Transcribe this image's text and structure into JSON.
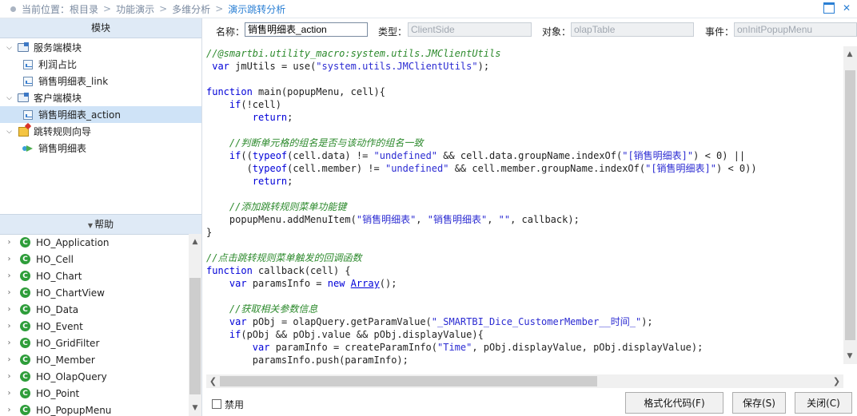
{
  "breadcrumb": {
    "prefix": "当前位置：",
    "items": [
      "根目录",
      "功能演示",
      "多维分析"
    ],
    "current": "演示跳转分析",
    "separator": ">"
  },
  "left_panel": {
    "module_header": "模块",
    "tree": [
      {
        "label": "服务端模块",
        "icon": "folder-icon",
        "expanded": true
      },
      {
        "label": "利润占比",
        "icon": "macro-doc-icon"
      },
      {
        "label": "销售明细表_link",
        "icon": "macro-doc-icon"
      },
      {
        "label": "客户端模块",
        "icon": "folder-icon",
        "expanded": true
      },
      {
        "label": "销售明细表_action",
        "icon": "macro-doc-icon",
        "selected": true
      },
      {
        "label": "跳转规则向导",
        "icon": "wizard-icon",
        "expanded": true
      },
      {
        "label": "销售明细表",
        "icon": "jump-rule-icon"
      }
    ],
    "help_header": "帮助",
    "help_items": [
      "HO_Application",
      "HO_Cell",
      "HO_Chart",
      "HO_ChartView",
      "HO_Data",
      "HO_Event",
      "HO_GridFilter",
      "HO_Member",
      "HO_OlapQuery",
      "HO_Point",
      "HO_PopupMenu"
    ]
  },
  "props": {
    "name_label": "名称：",
    "name_value": "销售明细表_action",
    "type_label": "类型：",
    "type_value": "ClientSide",
    "object_label": "对象：",
    "object_value": "olapTable",
    "event_label": "事件：",
    "event_value": "onInitPopupMenu"
  },
  "code_lines": [
    [
      {
        "t": "//@smartbi.utility_macro:system.utils.JMClientUtils",
        "c": "cm"
      }
    ],
    [
      {
        "t": " "
      },
      {
        "t": "var",
        "c": "kw"
      },
      {
        "t": " jmUtils = use("
      },
      {
        "t": "\"system.utils.JMClientUtils\"",
        "c": "str"
      },
      {
        "t": ");"
      }
    ],
    [],
    [
      {
        "t": "function",
        "c": "kw"
      },
      {
        "t": " main(popupMenu, cell){"
      }
    ],
    [
      {
        "t": "    "
      },
      {
        "t": "if",
        "c": "kw"
      },
      {
        "t": "(!cell)"
      }
    ],
    [
      {
        "t": "        "
      },
      {
        "t": "return",
        "c": "kw"
      },
      {
        "t": ";"
      }
    ],
    [],
    [
      {
        "t": "    "
      },
      {
        "t": "//判断单元格的组名是否与该动作的组名一致",
        "c": "cm"
      }
    ],
    [
      {
        "t": "    "
      },
      {
        "t": "if",
        "c": "kw"
      },
      {
        "t": "(("
      },
      {
        "t": "typeof",
        "c": "kw"
      },
      {
        "t": "(cell.data) != "
      },
      {
        "t": "\"undefined\"",
        "c": "str"
      },
      {
        "t": " && cell.data.groupName.indexOf("
      },
      {
        "t": "\"[销售明细表]\"",
        "c": "str"
      },
      {
        "t": ") < 0) ||"
      }
    ],
    [
      {
        "t": "       ("
      },
      {
        "t": "typeof",
        "c": "kw"
      },
      {
        "t": "(cell.member) != "
      },
      {
        "t": "\"undefined\"",
        "c": "str"
      },
      {
        "t": " && cell.member.groupName.indexOf("
      },
      {
        "t": "\"[销售明细表]\"",
        "c": "str"
      },
      {
        "t": ") < 0))"
      }
    ],
    [
      {
        "t": "        "
      },
      {
        "t": "return",
        "c": "kw"
      },
      {
        "t": ";"
      }
    ],
    [],
    [
      {
        "t": "    "
      },
      {
        "t": "//添加跳转规则菜单功能键",
        "c": "cm"
      }
    ],
    [
      {
        "t": "    popupMenu.addMenuItem("
      },
      {
        "t": "\"销售明细表\"",
        "c": "str"
      },
      {
        "t": ", "
      },
      {
        "t": "\"销售明细表\"",
        "c": "str"
      },
      {
        "t": ", "
      },
      {
        "t": "\"\"",
        "c": "str"
      },
      {
        "t": ", callback);"
      }
    ],
    [
      {
        "t": "}"
      }
    ],
    [],
    [
      {
        "t": "//点击跳转规则菜单触发的回调函数",
        "c": "cm"
      }
    ],
    [
      {
        "t": "function",
        "c": "kw"
      },
      {
        "t": " callback(cell) {"
      }
    ],
    [
      {
        "t": "    "
      },
      {
        "t": "var",
        "c": "kw"
      },
      {
        "t": " paramsInfo = "
      },
      {
        "t": "new",
        "c": "kw"
      },
      {
        "t": " "
      },
      {
        "t": "Array",
        "c": "ul"
      },
      {
        "t": "();"
      }
    ],
    [],
    [
      {
        "t": "    "
      },
      {
        "t": "//获取相关参数信息",
        "c": "cm"
      }
    ],
    [
      {
        "t": "    "
      },
      {
        "t": "var",
        "c": "kw"
      },
      {
        "t": " pObj = olapQuery.getParamValue("
      },
      {
        "t": "\"_SMARTBI_Dice_CustomerMember__时间_\"",
        "c": "str"
      },
      {
        "t": ");"
      }
    ],
    [
      {
        "t": "    "
      },
      {
        "t": "if",
        "c": "kw"
      },
      {
        "t": "(pObj && pObj.value && pObj.displayValue){"
      }
    ],
    [
      {
        "t": "        "
      },
      {
        "t": "var",
        "c": "kw"
      },
      {
        "t": " paramInfo = createParamInfo("
      },
      {
        "t": "\"Time\"",
        "c": "str"
      },
      {
        "t": ", pObj.displayValue, pObj.displayValue);"
      }
    ],
    [
      {
        "t": "        paramsInfo.push(paramInfo);"
      }
    ],
    [
      {
        "t": "    }"
      }
    ]
  ],
  "footer": {
    "disable_label": "禁用",
    "format_button": "格式化代码(F)",
    "save_button": "保存(S)",
    "close_button": "关闭(C)"
  }
}
